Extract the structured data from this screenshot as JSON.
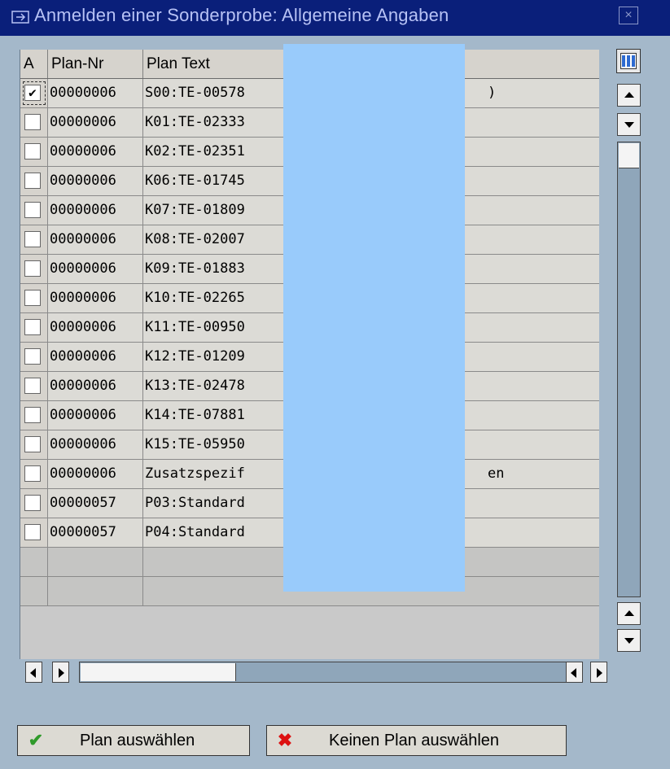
{
  "window": {
    "title": "Anmelden einer Sonderprobe: Allgemeine Angaben",
    "close_glyph": "×"
  },
  "table": {
    "headers": [
      "A",
      "Plan-Nr",
      "Plan Text"
    ],
    "rows": [
      {
        "checked": true,
        "plan_nr": "00000006",
        "plan_text": "S00:TE-00578",
        "suffix": ")"
      },
      {
        "checked": false,
        "plan_nr": "00000006",
        "plan_text": "K01:TE-02333",
        "suffix": ""
      },
      {
        "checked": false,
        "plan_nr": "00000006",
        "plan_text": "K02:TE-02351",
        "suffix": ""
      },
      {
        "checked": false,
        "plan_nr": "00000006",
        "plan_text": "K06:TE-01745",
        "suffix": ""
      },
      {
        "checked": false,
        "plan_nr": "00000006",
        "plan_text": "K07:TE-01809",
        "suffix": ""
      },
      {
        "checked": false,
        "plan_nr": "00000006",
        "plan_text": "K08:TE-02007",
        "suffix": ""
      },
      {
        "checked": false,
        "plan_nr": "00000006",
        "plan_text": "K09:TE-01883",
        "suffix": ""
      },
      {
        "checked": false,
        "plan_nr": "00000006",
        "plan_text": "K10:TE-02265",
        "suffix": ""
      },
      {
        "checked": false,
        "plan_nr": "00000006",
        "plan_text": "K11:TE-00950",
        "suffix": ""
      },
      {
        "checked": false,
        "plan_nr": "00000006",
        "plan_text": "K12:TE-01209",
        "suffix": ""
      },
      {
        "checked": false,
        "plan_nr": "00000006",
        "plan_text": "K13:TE-02478",
        "suffix": ""
      },
      {
        "checked": false,
        "plan_nr": "00000006",
        "plan_text": "K14:TE-07881",
        "suffix": ""
      },
      {
        "checked": false,
        "plan_nr": "00000006",
        "plan_text": "K15:TE-05950",
        "suffix": ""
      },
      {
        "checked": false,
        "plan_nr": "00000006",
        "plan_text": "Zusatzspezif",
        "suffix": "en"
      },
      {
        "checked": false,
        "plan_nr": "00000057",
        "plan_text": "P03:Standard",
        "suffix": ""
      },
      {
        "checked": false,
        "plan_nr": "00000057",
        "plan_text": "P04:Standard",
        "suffix": ""
      }
    ],
    "empty_rows": 2,
    "checkmark_glyph": "✔"
  },
  "buttons": {
    "select_plan": "Plan auswählen",
    "no_plan": "Keinen Plan auswählen",
    "select_icon": "✔",
    "no_plan_icon": "✖"
  },
  "colors": {
    "title_bar": "#0a1f7a",
    "window_bg": "#a4b8ca",
    "redaction": "#99cbfb"
  }
}
